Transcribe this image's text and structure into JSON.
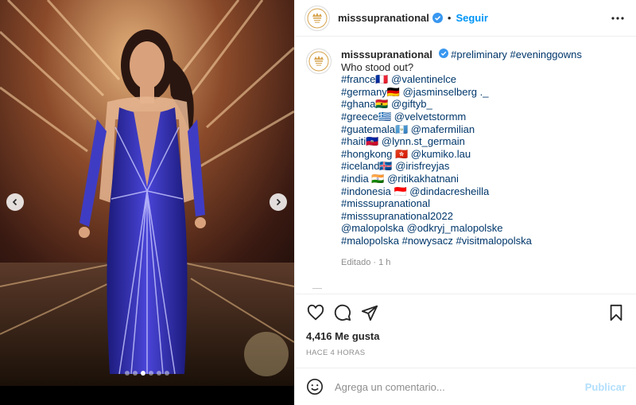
{
  "post": {
    "username": "misssupranational",
    "follow_label": "Seguir",
    "caption_lines": [
      {
        "parts": [
          {
            "t": "#preliminary #eveninggowns",
            "tag": true
          }
        ]
      },
      {
        "parts": [
          {
            "t": "Who stood out?",
            "tag": false
          }
        ]
      },
      {
        "parts": [
          {
            "t": "#france🇫🇷 @valentinelce",
            "tag": true
          }
        ]
      },
      {
        "parts": [
          {
            "t": "#germany🇩🇪 @jasminselberg ._",
            "tag": true
          }
        ]
      },
      {
        "parts": [
          {
            "t": "#ghana🇬🇭 @giftyb_",
            "tag": true
          }
        ]
      },
      {
        "parts": [
          {
            "t": "#greece🇬🇷 @velvetstormm",
            "tag": true
          }
        ]
      },
      {
        "parts": [
          {
            "t": "#guatemala🇬🇹 @mafermilian",
            "tag": true
          }
        ]
      },
      {
        "parts": [
          {
            "t": "#haiti🇭🇹 @lynn.st_germain",
            "tag": true
          }
        ]
      },
      {
        "parts": [
          {
            "t": "#hongkong 🇭🇰 @kumiko.lau",
            "tag": true
          }
        ]
      },
      {
        "parts": [
          {
            "t": "#iceland🇮🇸 @irisfreyjas",
            "tag": true
          }
        ]
      },
      {
        "parts": [
          {
            "t": "#india 🇮🇳 @ritikakhatnani",
            "tag": true
          }
        ]
      },
      {
        "parts": [
          {
            "t": "#indonesia 🇮🇩 @dindacresheilla",
            "tag": true
          }
        ]
      },
      {
        "parts": [
          {
            "t": "#misssupranational",
            "tag": true
          }
        ]
      },
      {
        "parts": [
          {
            "t": "#misssupranational2022",
            "tag": true
          }
        ]
      },
      {
        "parts": [
          {
            "t": "@malopolska @odkryj_malopolske",
            "tag": true
          }
        ]
      },
      {
        "parts": [
          {
            "t": "#malopolska #nowysacz #visitmalopolska",
            "tag": true
          }
        ]
      }
    ],
    "edited_label": "Editado · 1 h",
    "likes": "4,416 Me gusta",
    "timestamp": "HACE 4 HORAS",
    "comment_placeholder": "Agrega un comentario...",
    "publish_label": "Publicar",
    "carousel": {
      "slides": 6,
      "active": 3
    },
    "colors": {
      "link_blue": "#0095f6",
      "tag_blue": "#00376b",
      "verified": "#3897f0",
      "muted": "#8e8e8e",
      "publish_disabled": "#b2dffc"
    }
  },
  "icons": {
    "verified": "verified-badge-icon",
    "more": "more-options-icon",
    "like": "heart-icon",
    "comment": "comment-icon",
    "share": "paper-plane-icon",
    "save": "bookmark-icon",
    "emoji": "emoji-icon",
    "prev": "chevron-left-icon",
    "next": "chevron-right-icon"
  }
}
